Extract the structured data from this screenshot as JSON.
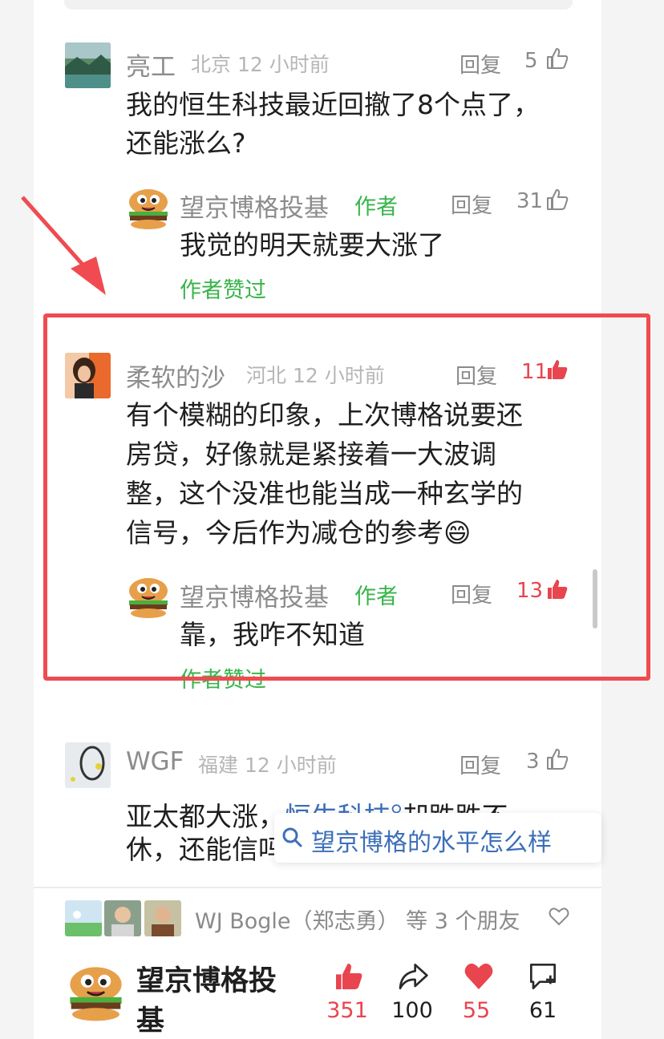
{
  "comments": [
    {
      "user": "亮工",
      "location_time": "北京 12 小时前",
      "reply_label": "回复",
      "likes": "5",
      "text_lines": [
        "我的恒生科技最近回撤了8个点了，",
        "还能涨么?"
      ],
      "author_reply": {
        "user": "望京博格投基",
        "author_tag": "作者",
        "reply_label": "回复",
        "likes": "31",
        "text": "我觉的明天就要大涨了",
        "liked_by_author": "作者赞过"
      }
    },
    {
      "user": "柔软的沙",
      "location_time": "河北 12 小时前",
      "reply_label": "回复",
      "likes": "11",
      "text_lines": [
        "有个模糊的印象，上次博格说要还",
        "房贷，好像就是紧接着一大波调",
        "整，这个没准也能当成一种玄学的",
        "信号，今后作为减仓的参考😄"
      ],
      "author_reply": {
        "user": "望京博格投基",
        "author_tag": "作者",
        "reply_label": "回复",
        "likes": "13",
        "text": "靠，我咋不知道",
        "liked_by_author": "作者赞过"
      }
    },
    {
      "user": "WGF",
      "location_time": "福建 12 小时前",
      "reply_label": "回复",
      "likes": "3",
      "text_line1_a": "亚太都大涨，",
      "text_line1_link": "恒生科技",
      "text_line1_b": "却跌跌不",
      "text_line2": "休，还能信吗"
    }
  ],
  "search_suggestion": "望京博格的水平怎么样",
  "friends_liked": "WJ Bogle（郑志勇） 等 3 个朋友",
  "footer": {
    "author_name_line1": "望京博格投",
    "author_name_line2": "基",
    "like_count": "351",
    "share_count": "100",
    "favorite_count": "55",
    "comment_count": "61"
  },
  "colors": {
    "accent_red": "#ef4b50",
    "author_green": "#38b44a",
    "link_blue": "#3c6fb8"
  }
}
